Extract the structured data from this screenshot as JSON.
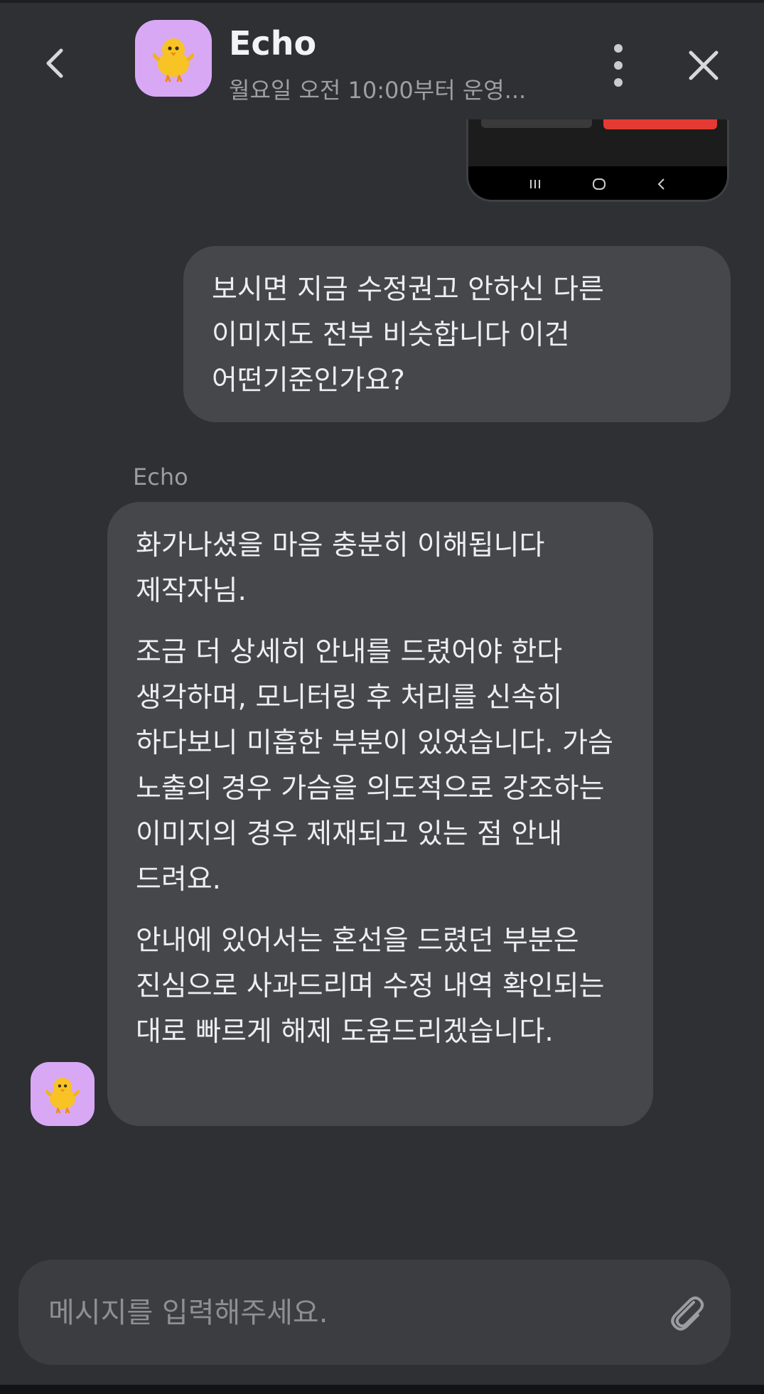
{
  "header": {
    "title": "Echo",
    "subtitle": "월요일 오전 10:00부터 운영...",
    "avatar_icon": "chick-icon"
  },
  "messages": [
    {
      "sender": "user",
      "text": "보시면 지금 수정권고 안하신 다른 이미지도 전부 비슷합니다 이건 어떤기준인가요?"
    },
    {
      "sender": "bot",
      "sender_name": "Echo",
      "paragraphs": [
        "화가나셨을 마음 충분히 이해됩니다 제작자님.",
        "조금 더 상세히 안내를 드렸어야 한다 생각하며, 모니터링 후 처리를 신속히 하다보니 미흡한 부분이 있었습니다. 가슴 노출의 경우 가슴을 의도적으로 강조하는 이미지의 경우 제재되고 있는 점 안내 드려요.",
        "안내에 있어서는 혼선을 드렸던 부분은 진심으로 사과드리며 수정 내역 확인되는 대로 빠르게 해제 도움드리겠습니다."
      ]
    }
  ],
  "input": {
    "placeholder": "메시지를 입력해주세요.",
    "value": ""
  },
  "colors": {
    "background": "#2e3033",
    "bubble": "#45474b",
    "avatar_bg": "#d9a8f4",
    "red_button": "#e43a33"
  }
}
